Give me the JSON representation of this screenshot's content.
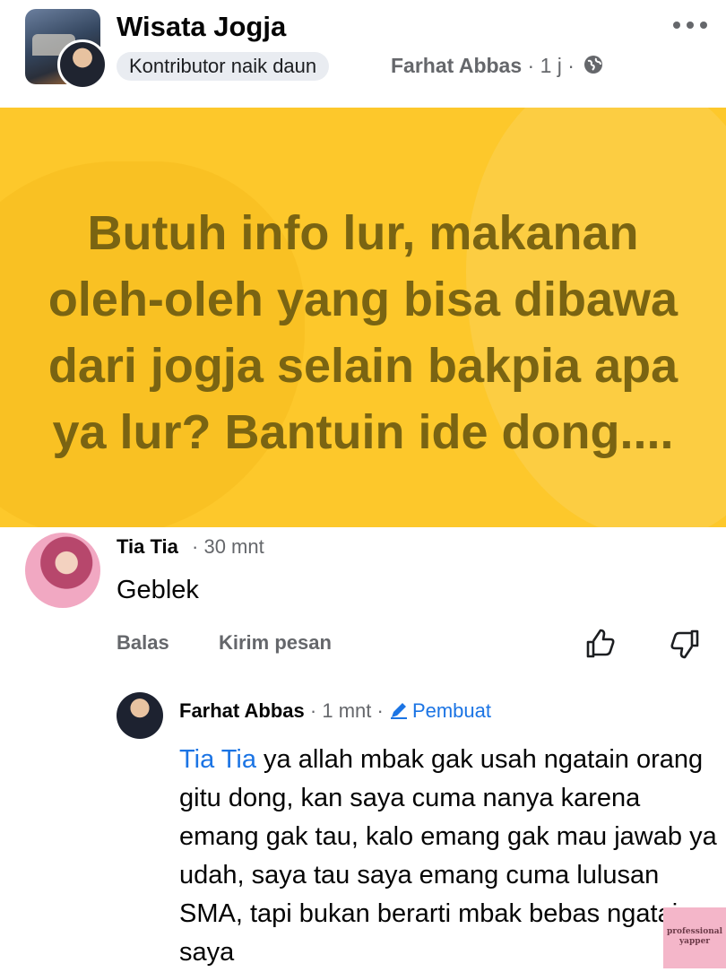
{
  "group": {
    "name": "Wisata Jogja"
  },
  "post": {
    "badge": "Kontributor naik daun",
    "author": "Farhat Abbas",
    "meta_separator": "·",
    "time": "1 j",
    "banner_text": "Butuh info lur, makanan oleh-oleh yang bisa dibawa dari jogja selain bakpia apa ya lur? Bantuin ide dong....",
    "banner_color": "#fdc82b",
    "icons": [
      "globe-icon",
      "more-options-icon"
    ]
  },
  "comment": {
    "name": "Tia Tia",
    "time": "30 mnt",
    "text": "Geblek",
    "actions": {
      "reply": "Balas",
      "message": "Kirim pesan"
    },
    "icons": [
      "thumbs-up-icon",
      "thumbs-down-icon"
    ]
  },
  "reply": {
    "name": "Farhat Abbas",
    "time": "1 mnt",
    "creator_label": "Pembuat",
    "mention": "Tia Tia",
    "text": " ya allah mbak gak usah ngatain orang gitu dong, kan saya cuma nanya karena emang gak tau, kalo emang gak mau jawab ya udah, saya tau saya emang cuma lulusan SMA, tapi bukan berarti mbak bebas ngatain saya",
    "icons": [
      "pencil-icon"
    ]
  },
  "watermark": {
    "line1": "professional",
    "line2": "yapper"
  },
  "colors": {
    "link": "#1b74e4",
    "muted": "#65676b",
    "banner_text": "#7a6412"
  }
}
